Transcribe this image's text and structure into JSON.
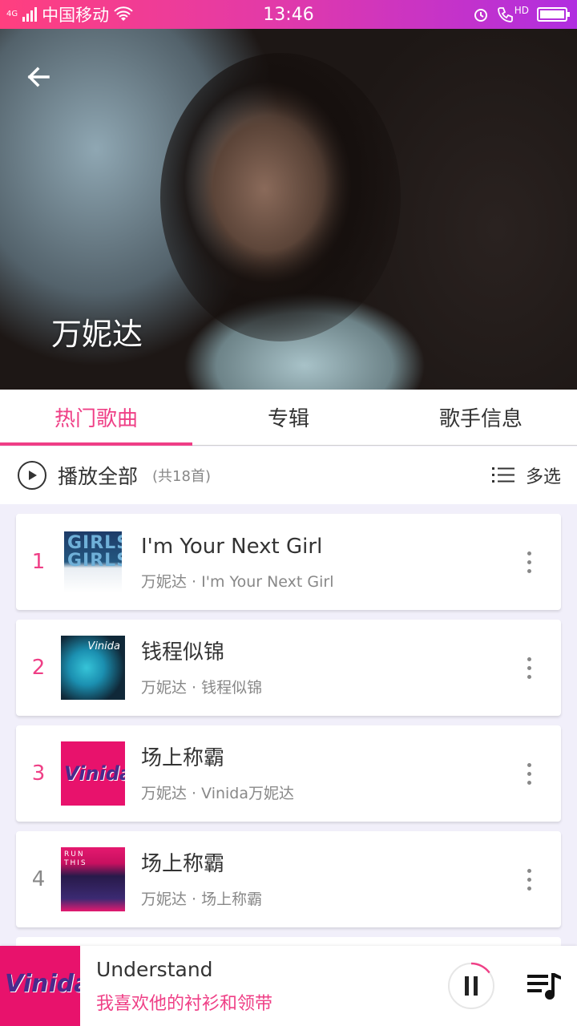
{
  "status_bar": {
    "network": "4G",
    "carrier": "中国移动",
    "time": "13:46",
    "hd": "HD"
  },
  "header": {
    "artist_name": "万妮达"
  },
  "tabs": [
    {
      "label": "热门歌曲",
      "active": true
    },
    {
      "label": "专辑",
      "active": false
    },
    {
      "label": "歌手信息",
      "active": false
    }
  ],
  "play_all": {
    "label": "播放全部",
    "count": "(共18首)",
    "multi_select": "多选"
  },
  "songs": [
    {
      "index": "1",
      "title": "I'm Your Next Girl",
      "subtitle": "万妮达 · I'm Your Next Girl",
      "cover_text": "GIRLS GIRLS"
    },
    {
      "index": "2",
      "title": "钱程似锦",
      "subtitle": "万妮达 · 钱程似锦",
      "cover_text": "Vinida"
    },
    {
      "index": "3",
      "title": "场上称霸",
      "subtitle": "万妮达 · Vinida万妮达",
      "cover_text": "Vinida"
    },
    {
      "index": "4",
      "title": "场上称霸",
      "subtitle": "万妮达 · 场上称霸",
      "cover_text": "RUN THIS"
    }
  ],
  "now_playing": {
    "title": "Understand",
    "subtitle": "我喜欢他的衬衫和领带",
    "cover_text": "Vinida",
    "progress": 0.15
  },
  "colors": {
    "accent": "#ef3f86",
    "status_bar_start": "#ff3f7f",
    "status_bar_end": "#b02ee0"
  }
}
